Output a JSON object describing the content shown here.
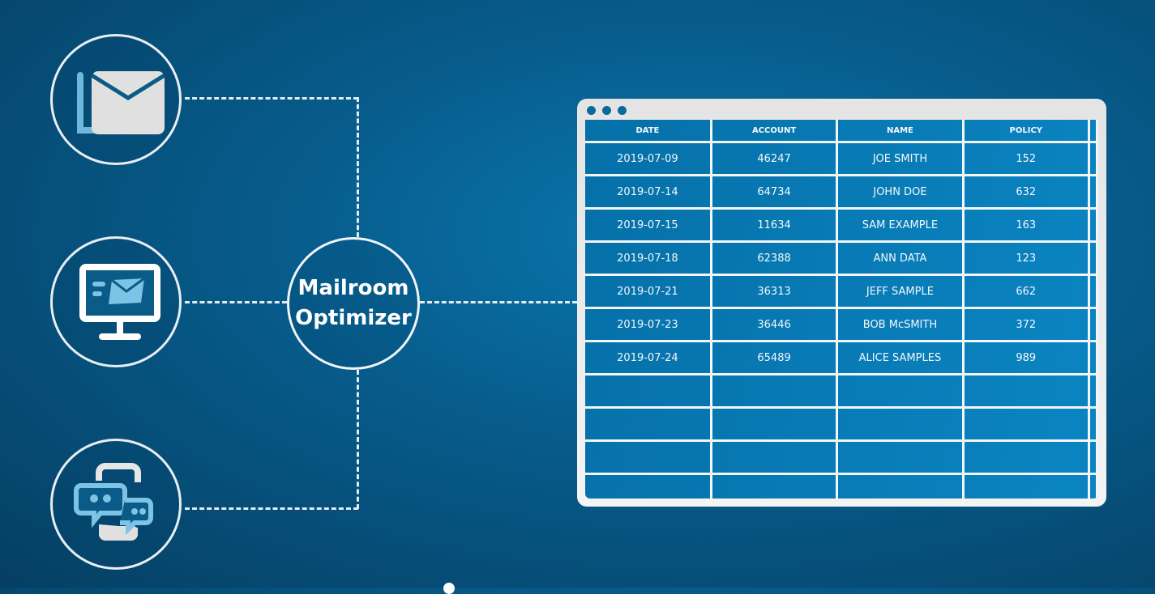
{
  "diagram": {
    "hub_label_line1": "Mailroom",
    "hub_label_line2": "Optimizer",
    "inputs": [
      {
        "name": "email",
        "icon": "envelope-stack-icon"
      },
      {
        "name": "web-portal",
        "icon": "monitor-mail-icon"
      },
      {
        "name": "mobile-chat",
        "icon": "phone-chat-icon"
      }
    ]
  },
  "table": {
    "columns": [
      "DATE",
      "ACCOUNT",
      "NAME",
      "POLICY"
    ],
    "rows": [
      [
        "2019-07-09",
        "46247",
        "JOE SMITH",
        "152"
      ],
      [
        "2019-07-14",
        "64734",
        "JOHN DOE",
        "632"
      ],
      [
        "2019-07-15",
        "11634",
        "SAM EXAMPLE",
        "163"
      ],
      [
        "2019-07-18",
        "62388",
        "ANN DATA",
        "123"
      ],
      [
        "2019-07-21",
        "36313",
        "JEFF SAMPLE",
        "662"
      ],
      [
        "2019-07-23",
        "36446",
        "BOB McSMITH",
        "372"
      ],
      [
        "2019-07-24",
        "65489",
        "ALICE SAMPLES",
        "989"
      ]
    ],
    "empty_rows": 4
  },
  "colors": {
    "background": "#075d8d",
    "accent_light_blue": "#7cc3e6",
    "table_fill": "#0a7ab5",
    "window_frame": "#e8e8e8"
  }
}
